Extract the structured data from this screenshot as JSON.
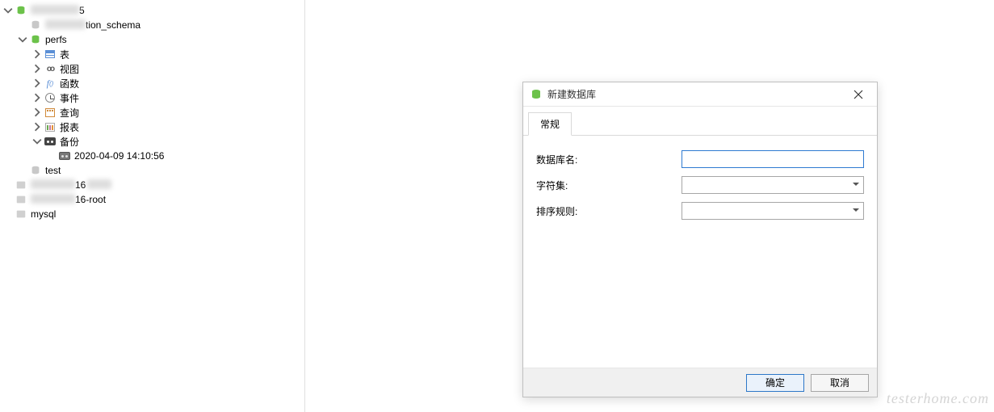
{
  "sidebar": {
    "root_conn_suffix": "5",
    "info_schema_suffix": "tion_schema",
    "perfs_db": "perfs",
    "children": {
      "tables": "表",
      "views": "视图",
      "functions": "函数",
      "events": "事件",
      "queries": "查询",
      "reports": "报表",
      "backups": "备份",
      "backup_file": "2020-04-09 14:10:56"
    },
    "test_db": "test",
    "conn2_suffix": "16",
    "conn3_suffix": "16-root",
    "conn4": "mysql"
  },
  "dialog": {
    "title": "新建数据库",
    "tab_general": "常规",
    "label_name": "数据库名:",
    "label_charset": "字符集:",
    "label_collation": "排序规则:",
    "name_value": "",
    "charset_value": "",
    "collation_value": "",
    "btn_ok": "确定",
    "btn_cancel": "取消"
  },
  "watermark": "testerhome.com"
}
